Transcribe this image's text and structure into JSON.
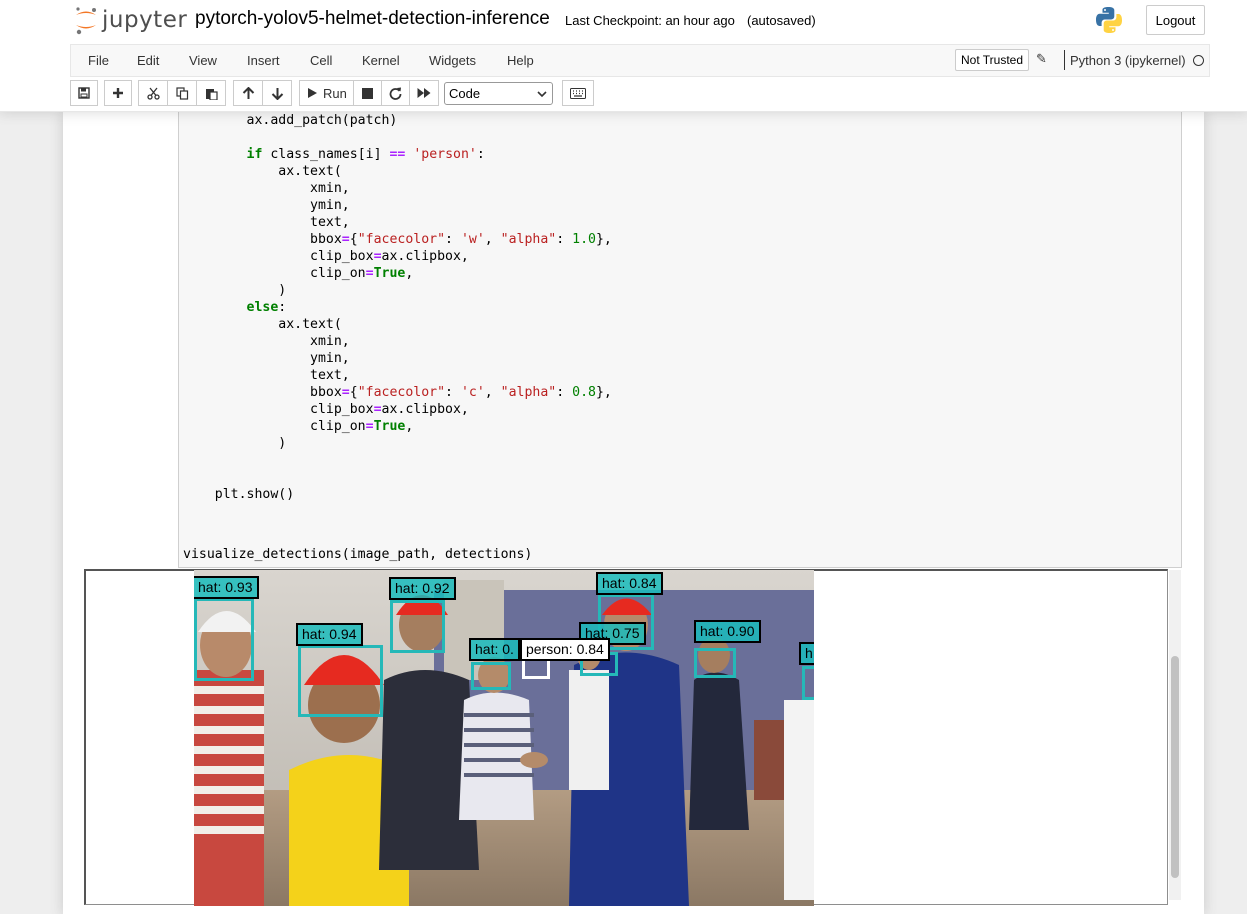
{
  "header": {
    "logo_text": "jupyter",
    "notebook_name": "pytorch-yolov5-helmet-detection-inference",
    "checkpoint": "Last Checkpoint: an hour ago",
    "autosave": "(autosaved)",
    "logout": "Logout"
  },
  "menu": {
    "items": [
      "File",
      "Edit",
      "View",
      "Insert",
      "Cell",
      "Kernel",
      "Widgets",
      "Help"
    ],
    "not_trusted": "Not Trusted",
    "kernel_name": "Python 3 (ipykernel)"
  },
  "toolbar": {
    "run_label": "Run",
    "cell_type": "Code",
    "icons": [
      "save-icon",
      "plus-icon",
      "cut-icon",
      "copy-icon",
      "paste-icon",
      "arrow-up-icon",
      "arrow-down-icon",
      "run-icon",
      "stop-icon",
      "restart-icon",
      "fast-forward-icon",
      "keyboard-icon"
    ]
  },
  "code": {
    "lines": [
      "        ax.add_patch(patch)",
      "",
      "        if class_names[i] == 'person':",
      "            ax.text(",
      "                xmin,",
      "                ymin,",
      "                text,",
      "                bbox={\"facecolor\": 'w', \"alpha\": 1.0},",
      "                clip_box=ax.clipbox,",
      "                clip_on=True,",
      "            )",
      "        else:",
      "            ax.text(",
      "                xmin,",
      "                ymin,",
      "                text,",
      "                bbox={\"facecolor\": 'c', \"alpha\": 0.8},",
      "                clip_box=ax.clipbox,",
      "                clip_on=True,",
      "            )",
      "",
      "",
      "    plt.show()"
    ],
    "next_cell": "visualize_detections(image_path, detections)"
  },
  "detections": [
    {
      "label": "hat: 0.93",
      "class": "hat"
    },
    {
      "label": "hat: 0.92",
      "class": "hat"
    },
    {
      "label": "hat: 0.84",
      "class": "hat"
    },
    {
      "label": "hat: 0.94",
      "class": "hat"
    },
    {
      "label": "hat: 0.75",
      "class": "hat"
    },
    {
      "label": "hat: 0.90",
      "class": "hat"
    },
    {
      "label": "hat: 0.",
      "class": "hat"
    },
    {
      "label": "person: 0.84",
      "class": "person"
    },
    {
      "label": "h",
      "class": "hat"
    }
  ],
  "colors": {
    "hat_box": "#25b8b8",
    "jupyter_orange": "#f37726",
    "keyword": "#008000",
    "string": "#ba2121",
    "operator": "#aa22ff"
  }
}
